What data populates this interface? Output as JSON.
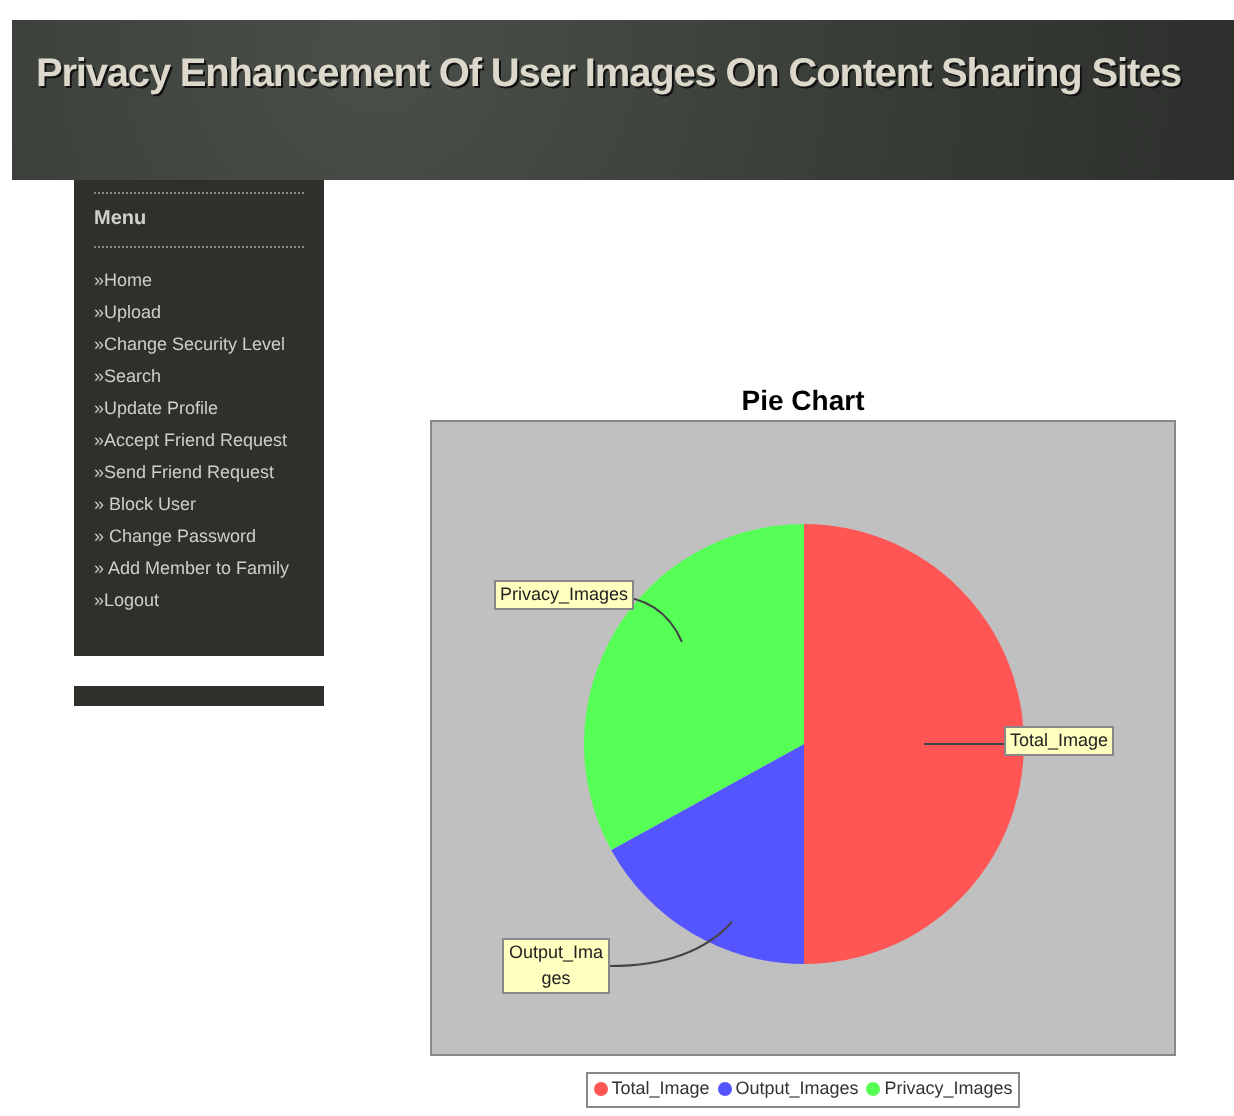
{
  "header": {
    "title": "Privacy Enhancement Of User Images On Content Sharing Sites"
  },
  "menu": {
    "title": "Menu",
    "items": [
      {
        "label": "»Home"
      },
      {
        "label": "»Upload"
      },
      {
        "label": "»Change Security Level"
      },
      {
        "label": "»Search"
      },
      {
        "label": "»Update Profile"
      },
      {
        "label": "»Accept Friend Request"
      },
      {
        "label": "»Send Friend Request"
      },
      {
        "label": "» Block User"
      },
      {
        "label": "» Change Password"
      },
      {
        "label": "» Add Member to Family"
      },
      {
        "label": "»Logout"
      }
    ]
  },
  "chart": {
    "chart_data": {
      "type": "pie",
      "title": "Pie Chart",
      "categories": [
        "Total_Image",
        "Output_Images",
        "Privacy_Images"
      ],
      "series": [
        {
          "values": [
            50,
            17,
            33
          ]
        }
      ],
      "legend": "bottom"
    },
    "callouts": [
      {
        "label": "Privacy_Images"
      },
      {
        "label": "Total_Image"
      },
      {
        "label": "Output_Images"
      }
    ],
    "slices": [
      {
        "color": "#ff5555"
      },
      {
        "color": "#5555ff"
      },
      {
        "color": "#55ff55"
      }
    ]
  }
}
